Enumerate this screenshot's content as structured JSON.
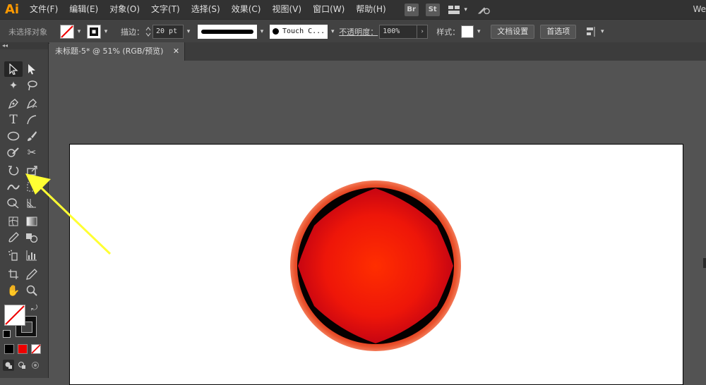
{
  "app": {
    "logo": "Ai"
  },
  "menubar": {
    "items": [
      "文件(F)",
      "编辑(E)",
      "对象(O)",
      "文字(T)",
      "选择(S)",
      "效果(C)",
      "视图(V)",
      "窗口(W)",
      "帮助(H)"
    ],
    "bridge": "Br",
    "stock": "St",
    "right_text": "We"
  },
  "control": {
    "selection": "未选择对象",
    "stroke_label": "描边：",
    "stroke_weight": "20 pt",
    "brush": "Touch C...",
    "opacity_label": "不透明度：",
    "opacity": "100%",
    "style_label": "样式：",
    "doc_setup": "文档设置",
    "preferences": "首选项"
  },
  "document": {
    "tab_title": "未标题-5* @ 51% (RGB/预览)",
    "close": "✕"
  },
  "colors": {
    "accent_logo": "#ff9a00",
    "circle_center": "#ff2a00",
    "circle_mid": "#dd0e0e",
    "circle_edge": "#ef6845",
    "annotation_arrow": "#ffff33"
  }
}
